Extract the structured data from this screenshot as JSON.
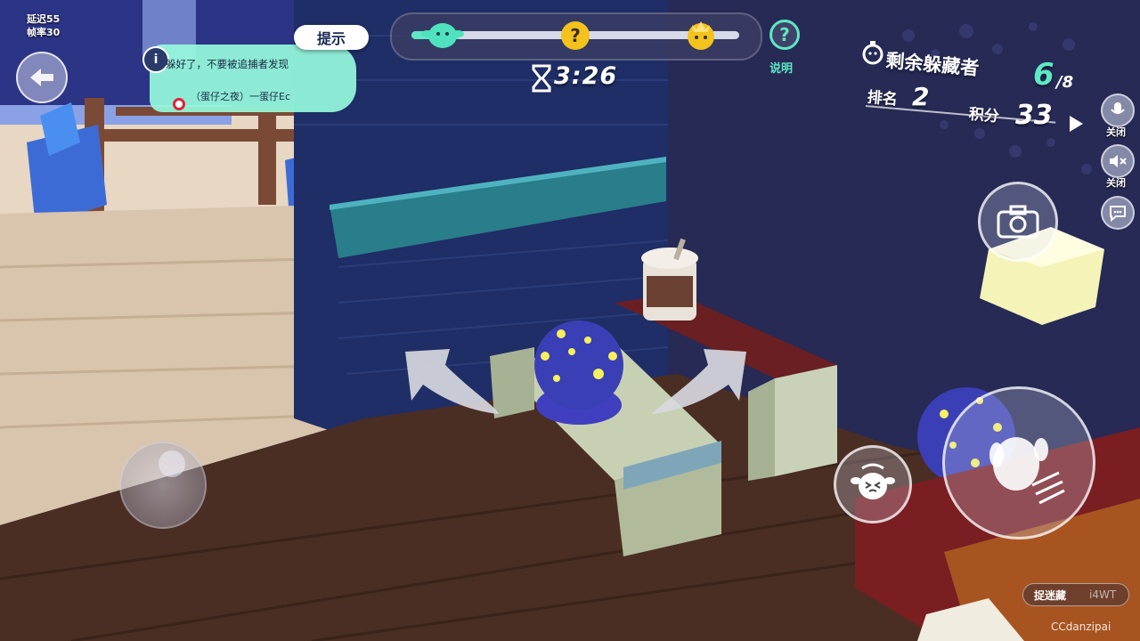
{
  "perf": {
    "latency": "延迟55",
    "fps": "帧率30"
  },
  "hint": {
    "tag": "提示",
    "info_icon": "i",
    "line1": "躲好了，不要被追捕者发现",
    "line2": "（蛋仔之夜）一蛋仔Ec"
  },
  "progress": {
    "fraction": 0.15,
    "icons": [
      "green-eggy-icon",
      "question-mark-icon",
      "gold-crown-eggy-icon"
    ]
  },
  "timer": {
    "value": "3:26"
  },
  "help": {
    "icon": "?",
    "label": "说明"
  },
  "stats": {
    "remaining_label": "剩余躲藏者",
    "remaining_current": "6",
    "remaining_total": "/8",
    "rank_label": "排名",
    "rank_value": "2",
    "score_label": "积分",
    "score_value": "33"
  },
  "side_controls": {
    "mic_label": "关闭",
    "speaker_label": "关闭"
  },
  "bottom": {
    "catch_label": "捉迷藏",
    "catch_code": "i4WT",
    "watermark": "CCdanzipai"
  },
  "colors": {
    "accent": "#5ee8c4",
    "panel": "#3c3e64",
    "hint_bubble": "#96fadc"
  }
}
